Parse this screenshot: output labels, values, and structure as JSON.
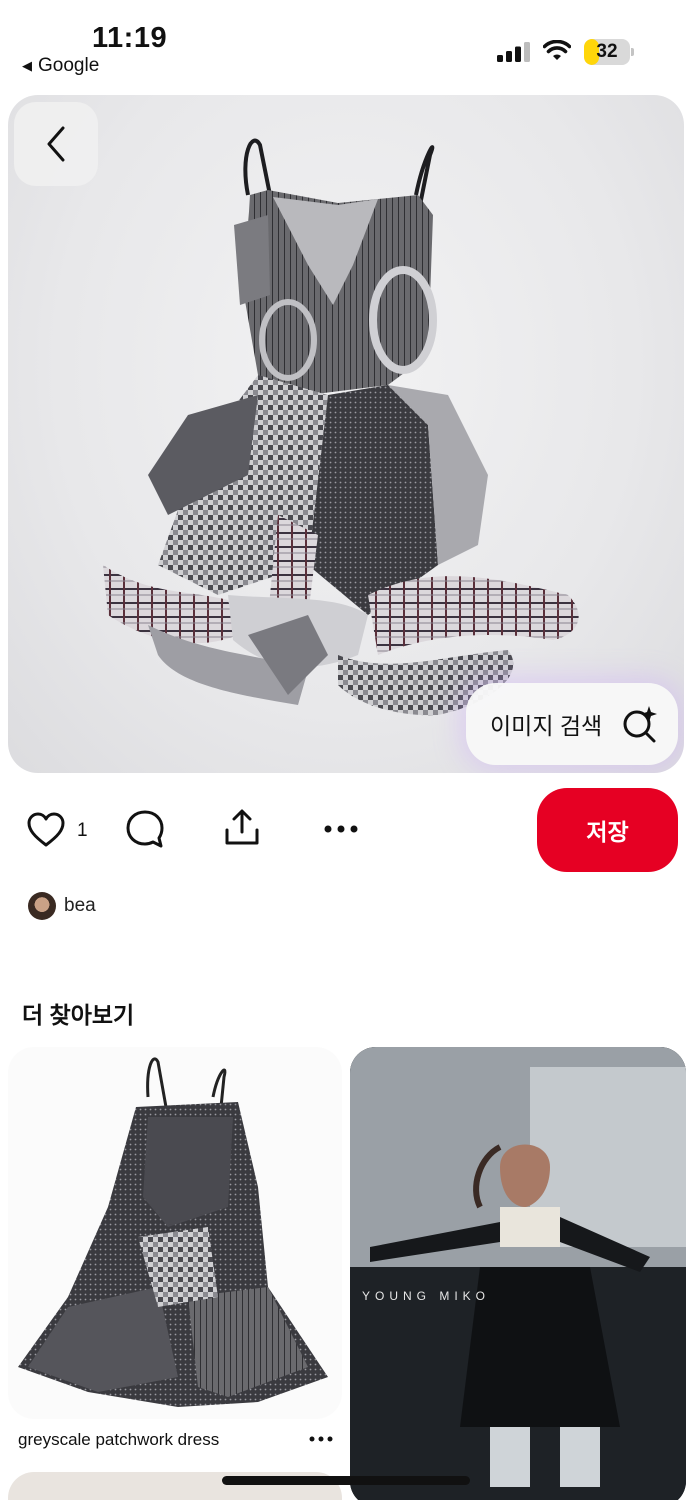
{
  "status_bar": {
    "time": "11:19",
    "back_app": "Google",
    "battery": "32",
    "battery_level": 0.32,
    "battery_color": "#ffd60a"
  },
  "hero": {
    "image_search_label": "이미지 검색",
    "icons": {
      "back": "chevron-left-icon",
      "image_search": "sparkle-search-icon"
    }
  },
  "actions": {
    "like_count": "1",
    "save_label": "저장",
    "save_color": "#e60023",
    "icons": [
      "heart-icon",
      "comment-icon",
      "share-icon",
      "more-icon"
    ]
  },
  "author": {
    "name": "bea"
  },
  "more_section": {
    "title": "더 찾아보기",
    "cards": [
      {
        "caption": "greyscale patchwork dress"
      },
      {
        "overlay_text": "YOUNG MIKO"
      }
    ]
  }
}
